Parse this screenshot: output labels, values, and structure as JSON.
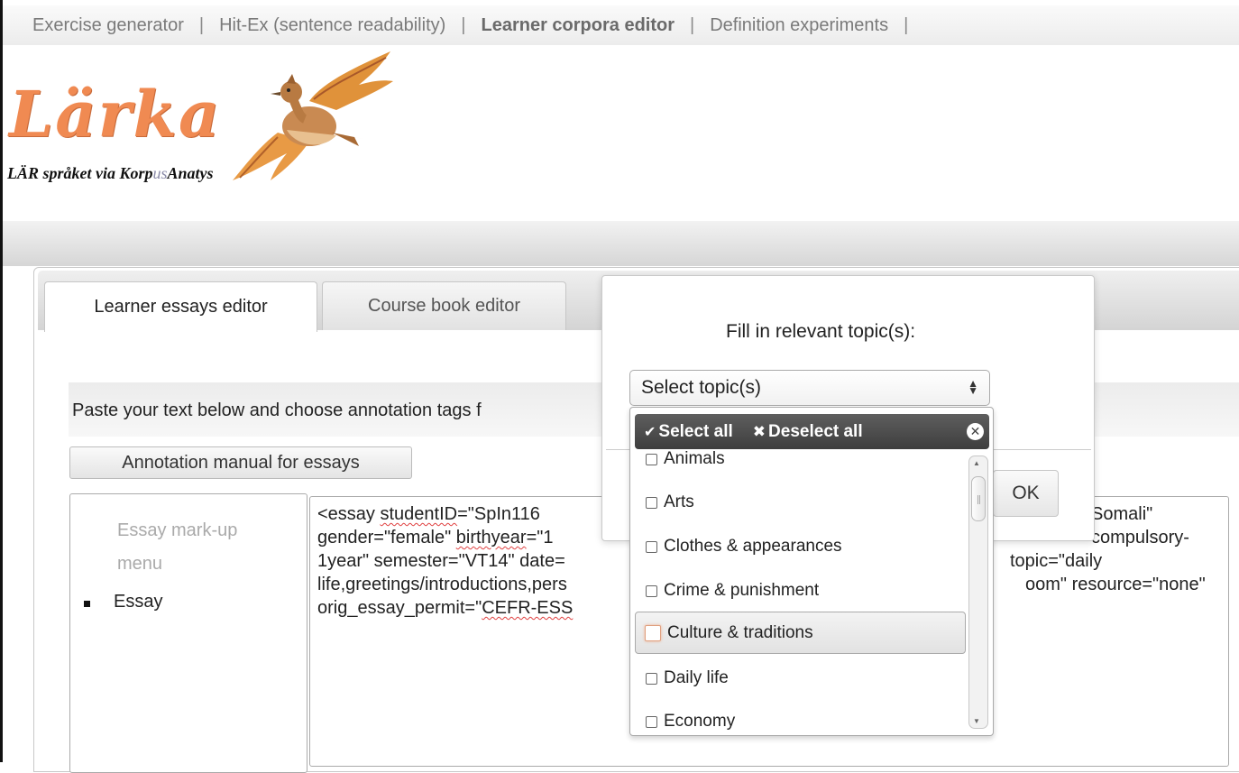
{
  "nav": {
    "items": [
      {
        "label": "Exercise generator",
        "active": false
      },
      {
        "label": "Hit-Ex (sentence readability)",
        "active": false
      },
      {
        "label": "Learner corpora editor",
        "active": true
      },
      {
        "label": "Definition experiments",
        "active": false
      }
    ],
    "separator": "|"
  },
  "logo": {
    "word": "Lärka",
    "tagline_a": "LÄR språket via Korp",
    "tagline_b": "us",
    "tagline_c": "Anatys"
  },
  "tabs": {
    "active_label": "Learner essays editor",
    "inactive_label": "Course book editor"
  },
  "instructions": "Paste your text below and choose annotation tags f",
  "manual_button": "Annotation manual for essays",
  "essay_menu": {
    "title_line1": "Essay mark-up",
    "title_line2": "menu",
    "item": "Essay"
  },
  "essay_text": {
    "l1a": "<essay ",
    "l1b": "studentID",
    "l1c": "=\"SpIn116",
    "l1d": "Somali\"",
    "l2a": "gender=\"female\" ",
    "l2b": "birthyear",
    "l2c": "=\"1",
    "l2d": "compulsory-",
    "l3a": "1year\" semester=\"VT14\" date=",
    "l3b": "topic=\"daily",
    "l4a": "life,greetings/introductions,pers",
    "l4b": "oom\" resource=\"none\"",
    "l5a": "orig_essay_permit=\"",
    "l5b": "CEFR-ESS"
  },
  "dialog": {
    "title": "Fill in relevant topic(s):",
    "ok_label": "OK"
  },
  "multiselect": {
    "button_label": "Select topic(s)",
    "select_all": "Select all",
    "deselect_all": "Deselect all",
    "options": [
      "Animals",
      "Arts",
      "Clothes & appearances",
      "Crime & punishment",
      "Culture & traditions",
      "Daily life",
      "Economy"
    ],
    "hovered_option": "Culture & traditions"
  },
  "colors": {
    "logo_orange": "#f08a52",
    "header_dark": "#4a4a4a",
    "nav_text": "#7a7a7a"
  }
}
